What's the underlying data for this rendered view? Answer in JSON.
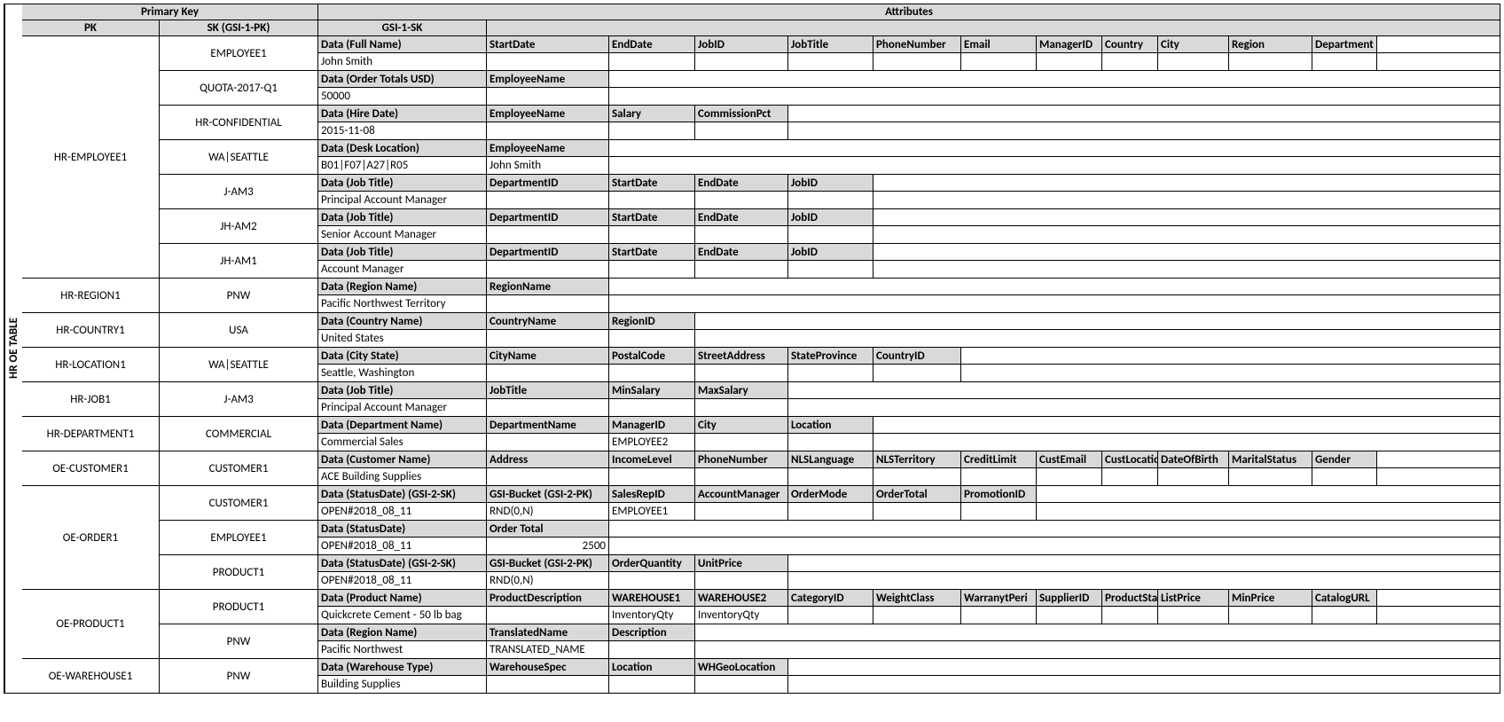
{
  "side_label": "HR OE TABLE",
  "header": {
    "primary_key": "Primary Key",
    "attributes": "Attributes",
    "pk": "PK",
    "sk": "SK (GSI-1-PK)",
    "gsi": "GSI-1-SK"
  },
  "pk_blocks": [
    {
      "pk": "HR-EMPLOYEE1",
      "sks": [
        {
          "sk": "EMPLOYEE1",
          "rows": [
            {
              "hdr": true,
              "cells": [
                "Data (Full Name)",
                "StartDate",
                "EndDate",
                "JobID",
                "JobTitle",
                "PhoneNumber",
                "Email",
                "ManagerID",
                "Country",
                "City",
                "Region",
                "Department"
              ]
            },
            {
              "hdr": false,
              "cells": [
                "John Smith",
                "",
                "",
                "",
                "",
                "",
                "",
                "",
                "",
                "",
                "",
                ""
              ]
            }
          ]
        },
        {
          "sk": "QUOTA-2017-Q1",
          "rows": [
            {
              "hdr": true,
              "cells": [
                "Data (Order Totals USD)",
                "EmployeeName"
              ]
            },
            {
              "hdr": false,
              "cells": [
                "50000",
                ""
              ]
            }
          ]
        },
        {
          "sk": "HR-CONFIDENTIAL",
          "rows": [
            {
              "hdr": true,
              "cells": [
                "Data (Hire Date)",
                "EmployeeName",
                "Salary",
                "CommissionPct"
              ]
            },
            {
              "hdr": false,
              "cells": [
                "2015-11-08",
                "",
                "",
                ""
              ]
            }
          ]
        },
        {
          "sk": "WA|SEATTLE",
          "rows": [
            {
              "hdr": true,
              "cells": [
                "Data (Desk Location)",
                "EmployeeName"
              ]
            },
            {
              "hdr": false,
              "cells": [
                "B01|F07|A27|R05",
                "John Smith"
              ]
            }
          ]
        },
        {
          "sk": "J-AM3",
          "rows": [
            {
              "hdr": true,
              "cells": [
                "Data (Job Title)",
                "DepartmentID",
                "StartDate",
                "EndDate",
                "JobID"
              ]
            },
            {
              "hdr": false,
              "cells": [
                "Principal Account Manager",
                "",
                "",
                "",
                ""
              ]
            }
          ]
        },
        {
          "sk": "JH-AM2",
          "rows": [
            {
              "hdr": true,
              "cells": [
                "Data (Job Title)",
                "DepartmentID",
                "StartDate",
                "EndDate",
                "JobID"
              ]
            },
            {
              "hdr": false,
              "cells": [
                "Senior Account Manager",
                "",
                "",
                "",
                ""
              ]
            }
          ]
        },
        {
          "sk": "JH-AM1",
          "rows": [
            {
              "hdr": true,
              "cells": [
                "Data (Job Title)",
                "DepartmentID",
                "StartDate",
                "EndDate",
                "JobID"
              ]
            },
            {
              "hdr": false,
              "cells": [
                "Account Manager",
                "",
                "",
                "",
                ""
              ]
            }
          ]
        }
      ]
    },
    {
      "pk": "HR-REGION1",
      "sks": [
        {
          "sk": "PNW",
          "rows": [
            {
              "hdr": true,
              "cells": [
                "Data (Region Name)",
                "RegionName"
              ]
            },
            {
              "hdr": false,
              "cells": [
                "Pacific Northwest Territory",
                ""
              ]
            }
          ]
        }
      ]
    },
    {
      "pk": "HR-COUNTRY1",
      "sks": [
        {
          "sk": "USA",
          "rows": [
            {
              "hdr": true,
              "cells": [
                "Data (Country Name)",
                "CountryName",
                "RegionID"
              ]
            },
            {
              "hdr": false,
              "cells": [
                "United States",
                "",
                ""
              ]
            }
          ]
        }
      ]
    },
    {
      "pk": "HR-LOCATION1",
      "sks": [
        {
          "sk": "WA|SEATTLE",
          "rows": [
            {
              "hdr": true,
              "cells": [
                "Data (City State)",
                "CityName",
                "PostalCode",
                "StreetAddress",
                "StateProvince",
                "CountryID"
              ]
            },
            {
              "hdr": false,
              "cells": [
                "Seattle, Washington",
                "",
                "",
                "",
                "",
                ""
              ]
            }
          ]
        }
      ]
    },
    {
      "pk": "HR-JOB1",
      "sks": [
        {
          "sk": "J-AM3",
          "rows": [
            {
              "hdr": true,
              "cells": [
                "Data (Job Title)",
                "JobTitle",
                "MinSalary",
                "MaxSalary"
              ]
            },
            {
              "hdr": false,
              "cells": [
                "Principal Account Manager",
                "",
                "",
                ""
              ]
            }
          ]
        }
      ]
    },
    {
      "pk": "HR-DEPARTMENT1",
      "sks": [
        {
          "sk": "COMMERCIAL",
          "rows": [
            {
              "hdr": true,
              "cells": [
                "Data (Department Name)",
                "DepartmentName",
                "ManagerID",
                "City",
                "Location"
              ]
            },
            {
              "hdr": false,
              "cells": [
                "Commercial Sales",
                "",
                "EMPLOYEE2",
                "",
                ""
              ]
            }
          ]
        }
      ]
    },
    {
      "pk": "OE-CUSTOMER1",
      "sks": [
        {
          "sk": "CUSTOMER1",
          "rows": [
            {
              "hdr": true,
              "cells": [
                "Data (Customer Name)",
                "Address",
                "IncomeLevel",
                "PhoneNumber",
                "NLSLanguage",
                "NLSTerritory",
                "CreditLimit",
                "CustEmail",
                "CustLocatio",
                "DateOfBirth",
                "MaritalStatus",
                "Gender"
              ]
            },
            {
              "hdr": false,
              "cells": [
                "ACE Building Supplies",
                "",
                "",
                "",
                "",
                "",
                "",
                "",
                "",
                "",
                "",
                ""
              ]
            }
          ]
        }
      ]
    },
    {
      "pk": "OE-ORDER1",
      "sks": [
        {
          "sk": "CUSTOMER1",
          "rows": [
            {
              "hdr": true,
              "cells": [
                "Data (StatusDate) (GSI-2-SK)",
                "GSI-Bucket (GSI-2-PK)",
                "SalesRepID",
                "AccountManager",
                "OrderMode",
                "OrderTotal",
                "PromotionID"
              ]
            },
            {
              "hdr": false,
              "cells": [
                "OPEN#2018_08_11",
                "RND(0,N)",
                "EMPLOYEE1",
                "",
                "",
                "",
                ""
              ]
            }
          ]
        },
        {
          "sk": "EMPLOYEE1",
          "rows": [
            {
              "hdr": true,
              "cells": [
                "Data (StatusDate)",
                "Order Total"
              ]
            },
            {
              "hdr": false,
              "cells": [
                "OPEN#2018_08_11",
                "2500"
              ],
              "num_idx": 1
            }
          ]
        },
        {
          "sk": "PRODUCT1",
          "rows": [
            {
              "hdr": true,
              "cells": [
                "Data (StatusDate) (GSI-2-SK)",
                "GSI-Bucket (GSI-2-PK)",
                "OrderQuantity",
                "UnitPrice"
              ]
            },
            {
              "hdr": false,
              "cells": [
                "OPEN#2018_08_11",
                "RND(0,N)",
                "",
                ""
              ]
            }
          ]
        }
      ]
    },
    {
      "pk": "OE-PRODUCT1",
      "sks": [
        {
          "sk": "PRODUCT1",
          "rows": [
            {
              "hdr": true,
              "cells": [
                "Data (Product Name)",
                "ProductDescription",
                "WAREHOUSE1",
                "WAREHOUSE2",
                "CategoryID",
                "WeightClass",
                "WarranytPeri",
                "SupplierID",
                "ProductSta",
                "ListPrice",
                "MinPrice",
                "CatalogURL"
              ]
            },
            {
              "hdr": false,
              "cells": [
                "Quickcrete Cement - 50 lb bag",
                "",
                "InventoryQty",
                "InventoryQty",
                "",
                "",
                "",
                "",
                "",
                "",
                "",
                ""
              ]
            }
          ]
        },
        {
          "sk": "PNW",
          "rows": [
            {
              "hdr": true,
              "cells": [
                "Data (Region Name)",
                "TranslatedName",
                "Description"
              ]
            },
            {
              "hdr": false,
              "cells": [
                "Pacific Northwest",
                "TRANSLATED_NAME",
                ""
              ]
            }
          ]
        }
      ]
    },
    {
      "pk": "OE-WAREHOUSE1",
      "sks": [
        {
          "sk": "PNW",
          "rows": [
            {
              "hdr": true,
              "cells": [
                "Data (Warehouse Type)",
                "WarehouseSpec",
                "Location",
                "WHGeoLocation"
              ]
            },
            {
              "hdr": false,
              "cells": [
                "Building Supplies",
                "",
                "",
                ""
              ]
            }
          ]
        }
      ]
    }
  ]
}
